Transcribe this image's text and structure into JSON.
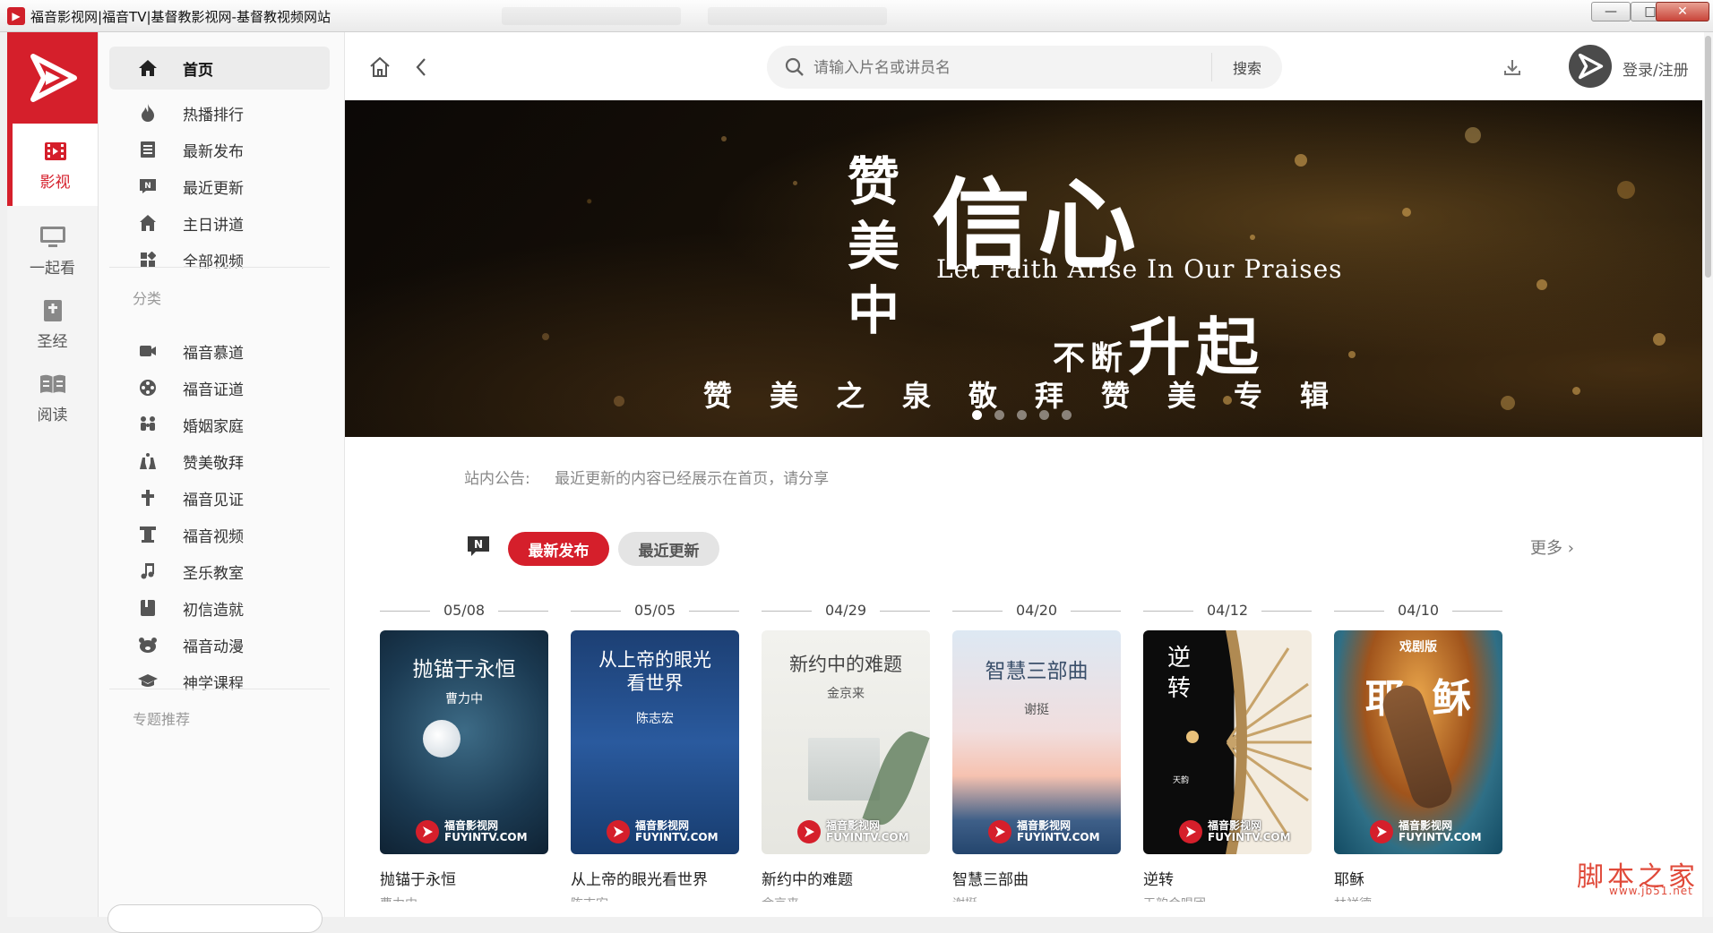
{
  "window": {
    "title": "福音影视网|福音TV|基督教影视网-基督教视频网站",
    "buttons": {
      "minimize": "—",
      "maximize": "□",
      "close": "✕"
    }
  },
  "rail": {
    "items": [
      {
        "label": "影视",
        "icon": "film-icon",
        "active": true
      },
      {
        "label": "一起看",
        "icon": "tv-icon"
      },
      {
        "label": "圣经",
        "icon": "bible-icon"
      },
      {
        "label": "阅读",
        "icon": "book-open-icon"
      }
    ]
  },
  "menu": {
    "main": [
      {
        "label": "首页",
        "icon": "home-icon",
        "active": true
      },
      {
        "label": "热播排行",
        "icon": "fire-icon"
      },
      {
        "label": "最新发布",
        "icon": "document-icon"
      },
      {
        "label": "最近更新",
        "icon": "new-badge-icon"
      },
      {
        "label": "主日讲道",
        "icon": "church-icon"
      },
      {
        "label": "全部视频",
        "icon": "grid-icon"
      }
    ],
    "category_heading": "分类",
    "categories": [
      {
        "label": "福音慕道",
        "icon": "video-icon"
      },
      {
        "label": "福音证道",
        "icon": "reel-icon"
      },
      {
        "label": "婚姻家庭",
        "icon": "family-icon"
      },
      {
        "label": "赞美敬拜",
        "icon": "praise-hands-icon"
      },
      {
        "label": "福音见证",
        "icon": "cross-icon"
      },
      {
        "label": "福音视频",
        "icon": "pillar-icon"
      },
      {
        "label": "圣乐教室",
        "icon": "music-note-icon"
      },
      {
        "label": "初信造就",
        "icon": "book-icon"
      },
      {
        "label": "福音动漫",
        "icon": "bear-icon"
      },
      {
        "label": "神学课程",
        "icon": "graduation-cap-icon"
      }
    ],
    "topic_heading": "专题推荐"
  },
  "topbar": {
    "search_placeholder": "请输入片名或讲员名",
    "search_button": "搜索",
    "login": "登录/注册"
  },
  "banner": {
    "vertical_text": [
      "赞",
      "美",
      "中"
    ],
    "headline": "信心",
    "english": "Let Faith Arise In Our Praises",
    "small": "不断",
    "big": "升起",
    "subtitle": "赞美之泉敬拜赞美专辑",
    "slide_count": 5,
    "active_slide": 1
  },
  "notice": {
    "label": "站内公告:",
    "text": "最近更新的内容已经展示在首页，请分享"
  },
  "section": {
    "tabs": [
      "最新发布",
      "最近更新"
    ],
    "active_tab": 0,
    "more": "更多 ›"
  },
  "cards": [
    {
      "date": "05/08",
      "poster_title": "抛锚于永恒",
      "poster_author": "曹力中",
      "name": "抛锚于永恒",
      "speaker": "曹力中"
    },
    {
      "date": "05/05",
      "poster_title": "从上帝的眼光\n看世界",
      "poster_author": "陈志宏",
      "name": "从上帝的眼光看世界",
      "speaker": "陈志宏"
    },
    {
      "date": "04/29",
      "poster_title": "新约中的难题",
      "poster_author": "金京来",
      "name": "新约中的难题",
      "speaker": "金京来"
    },
    {
      "date": "04/20",
      "poster_title": "智慧三部曲",
      "poster_author": "谢挺",
      "name": "智慧三部曲",
      "speaker": "谢挺"
    },
    {
      "date": "04/12",
      "poster_title": "逆\n转",
      "poster_author": "天韵",
      "name": "逆转",
      "speaker": "天韵合唱团"
    },
    {
      "date": "04/10",
      "poster_title": "耶  稣",
      "poster_author": "戏剧版",
      "name": "耶稣",
      "speaker": "林祥德"
    }
  ],
  "poster_brand": {
    "cn": "福音影视网",
    "en": "FUYINTV.COM"
  },
  "watermark": {
    "text": "脚本之家",
    "url": "www.jb51.net"
  },
  "colors": {
    "brand_red": "#d51f2b",
    "rail_bg": "#f4f4f4",
    "menu_bg": "#fafafa"
  }
}
